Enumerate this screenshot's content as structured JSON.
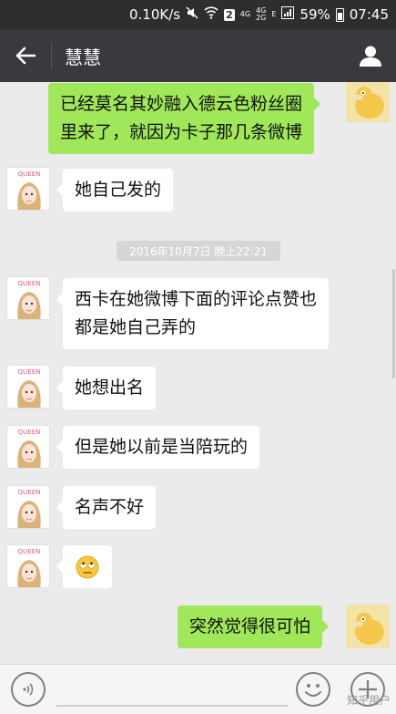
{
  "status_bar": {
    "network_speed": "0.10K/s",
    "sim_badge": "2",
    "network_4g_top": "4G",
    "network_4g_dual_top": "4G",
    "network_4g_dual_bottom": "2G",
    "network_e": "E",
    "battery": "59%",
    "time": "07:45"
  },
  "header": {
    "title": "慧慧"
  },
  "messages": [
    {
      "side": "right",
      "lines": [
        "已经莫名其妙融入德云色粉丝圈",
        "里来了，就因为卡子那几条微博"
      ]
    },
    {
      "side": "left",
      "lines": [
        "她自己发的"
      ]
    },
    {
      "side": "left",
      "lines": [
        "西卡在她微博下面的评论点赞也",
        "都是她自己弄的"
      ]
    },
    {
      "side": "left",
      "lines": [
        "她想出名"
      ]
    },
    {
      "side": "left",
      "lines": [
        "但是她以前是当陪玩的"
      ]
    },
    {
      "side": "left",
      "lines": [
        "名声不好"
      ]
    },
    {
      "side": "left",
      "emoji": "🙄"
    },
    {
      "side": "right",
      "lines": [
        "突然觉得很可怕"
      ]
    }
  ],
  "timestamp": "2016年10月7日 晚上22:21",
  "avatars": {
    "contact_label": "QUEEN"
  },
  "input_bar": {
    "watermark": "知乎用户"
  },
  "colors": {
    "status_bar": "#2e2e2e",
    "nav_bar": "#393a3f",
    "chat_background": "#ebebeb",
    "outgoing_bubble": "#a0e75a",
    "incoming_bubble": "#ffffff"
  },
  "icons": {
    "back": "back-arrow-icon",
    "contact": "person-icon",
    "voice": "voice-icon",
    "emoji": "emoji-icon",
    "more": "plus-icon"
  }
}
